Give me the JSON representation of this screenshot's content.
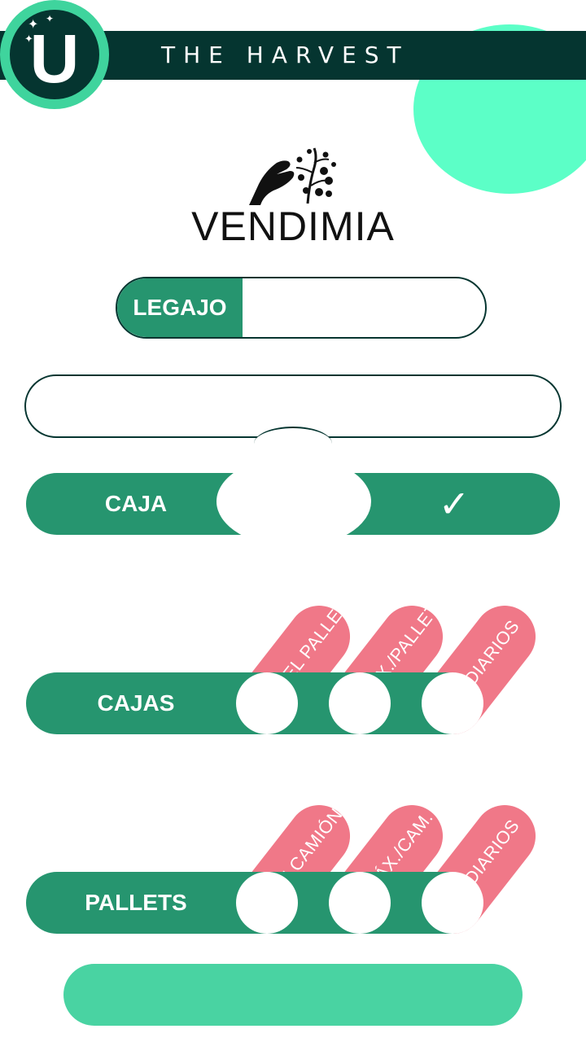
{
  "header": {
    "title": "THE HARVEST",
    "logo_letter": "U"
  },
  "brand": {
    "name": "VENDIMIA"
  },
  "legajo": {
    "label": "LEGAJO",
    "value": ""
  },
  "main_field": {
    "value": ""
  },
  "caja": {
    "label": "CAJA",
    "check": "✓"
  },
  "cajas": {
    "label": "CAJAS",
    "stats": [
      {
        "label": "EN EL PALLET",
        "value": ""
      },
      {
        "label": "MÁX./PALLET",
        "value": ""
      },
      {
        "label": "DIARIOS",
        "value": ""
      }
    ]
  },
  "pallets": {
    "label": "PALLETS",
    "stats": [
      {
        "label": "EN CAMIÓN",
        "value": ""
      },
      {
        "label": "MÁX./CAM.",
        "value": ""
      },
      {
        "label": "DIARIOS",
        "value": ""
      }
    ]
  },
  "bottom_button": {
    "label": ""
  },
  "colors": {
    "header_bg": "#053530",
    "primary_green": "#26956f",
    "mint_accent": "#5cffc7",
    "pink_tab": "#f07384",
    "button_green": "#49d3a2"
  }
}
